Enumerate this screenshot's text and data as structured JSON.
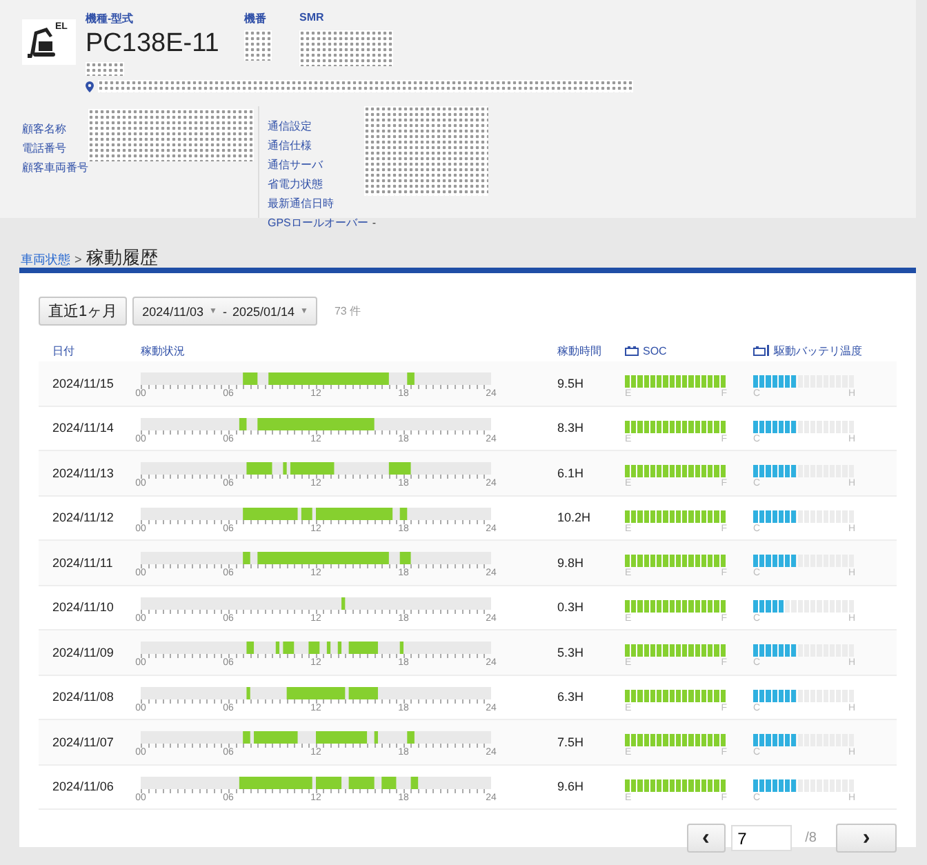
{
  "machine": {
    "logo_badge": "EL",
    "model_label": "機種-型式",
    "model": "PC138E-11",
    "model_sub_masked": true,
    "serial_label": "機番",
    "serial_masked": true,
    "smr_label": "SMR",
    "smr_masked": true,
    "location_masked": true
  },
  "info_left": {
    "masked": true,
    "fields": [
      {
        "label": "顧客名称"
      },
      {
        "label": "電話番号"
      },
      {
        "label": "顧客車両番号"
      }
    ]
  },
  "info_right": {
    "masked": true,
    "fields": [
      {
        "label": "通信設定"
      },
      {
        "label": "通信仕様"
      },
      {
        "label": "通信サーバ"
      },
      {
        "label": "省電力状態"
      },
      {
        "label": "最新通信日時"
      },
      {
        "label": "GPSロールオーバー",
        "value": "-"
      }
    ]
  },
  "breadcrumb": {
    "link": "車両状態",
    "separator": ">",
    "current": "稼動履歴"
  },
  "filters": {
    "preset": "直近1ヶ月",
    "date_from": "2024/11/03",
    "from_caret": "▼",
    "range_separator": "-",
    "date_to": "2025/01/14",
    "to_caret": "▼",
    "count": "73 件"
  },
  "columns": {
    "date": "日付",
    "status": "稼動状況",
    "hours": "稼動時間",
    "soc": "SOC",
    "temp": "駆動バッテリ温度"
  },
  "rows": [
    {
      "date": "2024/11/15",
      "ticks": [
        "00",
        "06",
        "12",
        "18",
        "24"
      ],
      "hours": "9.5H",
      "soc": {
        "level": 1,
        "low": "E",
        "high": "F"
      },
      "temp": {
        "level": 0.4375,
        "low": "C",
        "high": "H"
      }
    },
    {
      "date": "2024/11/14",
      "ticks": [
        "00",
        "06",
        "12",
        "18",
        "24"
      ],
      "hours": "8.3H",
      "soc": {
        "level": 1,
        "low": "E",
        "high": "F"
      },
      "temp": {
        "level": 0.4375,
        "low": "C",
        "high": "H"
      }
    },
    {
      "date": "2024/11/13",
      "ticks": [
        "00",
        "06",
        "12",
        "18",
        "24"
      ],
      "hours": "6.1H",
      "soc": {
        "level": 1,
        "low": "E",
        "high": "F"
      },
      "temp": {
        "level": 0.4375,
        "low": "C",
        "high": "H"
      }
    },
    {
      "date": "2024/11/12",
      "ticks": [
        "00",
        "06",
        "12",
        "18",
        "24"
      ],
      "hours": "10.2H",
      "soc": {
        "level": 1,
        "low": "E",
        "high": "F"
      },
      "temp": {
        "level": 0.4375,
        "low": "C",
        "high": "H"
      }
    },
    {
      "date": "2024/11/11",
      "ticks": [
        "00",
        "06",
        "12",
        "18",
        "24"
      ],
      "hours": "9.8H",
      "soc": {
        "level": 1,
        "low": "E",
        "high": "F"
      },
      "temp": {
        "level": 0.4375,
        "low": "C",
        "high": "H"
      }
    },
    {
      "date": "2024/11/10",
      "ticks": [
        "00",
        "06",
        "12",
        "18",
        "24"
      ],
      "hours": "0.3H",
      "soc": {
        "level": 1,
        "low": "E",
        "high": "F"
      },
      "temp": {
        "level": 0.3125,
        "low": "C",
        "high": "H"
      }
    },
    {
      "date": "2024/11/09",
      "ticks": [
        "00",
        "06",
        "12",
        "18",
        "24"
      ],
      "hours": "5.3H",
      "soc": {
        "level": 1,
        "low": "E",
        "high": "F"
      },
      "temp": {
        "level": 0.4375,
        "low": "C",
        "high": "H"
      }
    },
    {
      "date": "2024/11/08",
      "ticks": [
        "00",
        "06",
        "12",
        "18",
        "24"
      ],
      "hours": "6.3H",
      "soc": {
        "level": 1,
        "low": "E",
        "high": "F"
      },
      "temp": {
        "level": 0.4375,
        "low": "C",
        "high": "H"
      }
    },
    {
      "date": "2024/11/07",
      "ticks": [
        "00",
        "06",
        "12",
        "18",
        "24"
      ],
      "hours": "7.5H",
      "soc": {
        "level": 1,
        "low": "E",
        "high": "F"
      },
      "temp": {
        "level": 0.4375,
        "low": "C",
        "high": "H"
      }
    },
    {
      "date": "2024/11/06",
      "ticks": [
        "00",
        "06",
        "12",
        "18",
        "24"
      ],
      "hours": "9.6H",
      "soc": {
        "level": 1,
        "low": "E",
        "high": "F"
      },
      "temp": {
        "level": 0.4375,
        "low": "C",
        "high": "H"
      }
    }
  ],
  "pagination": {
    "prev": "‹",
    "page": "7",
    "total": "/8",
    "next": "›"
  }
}
